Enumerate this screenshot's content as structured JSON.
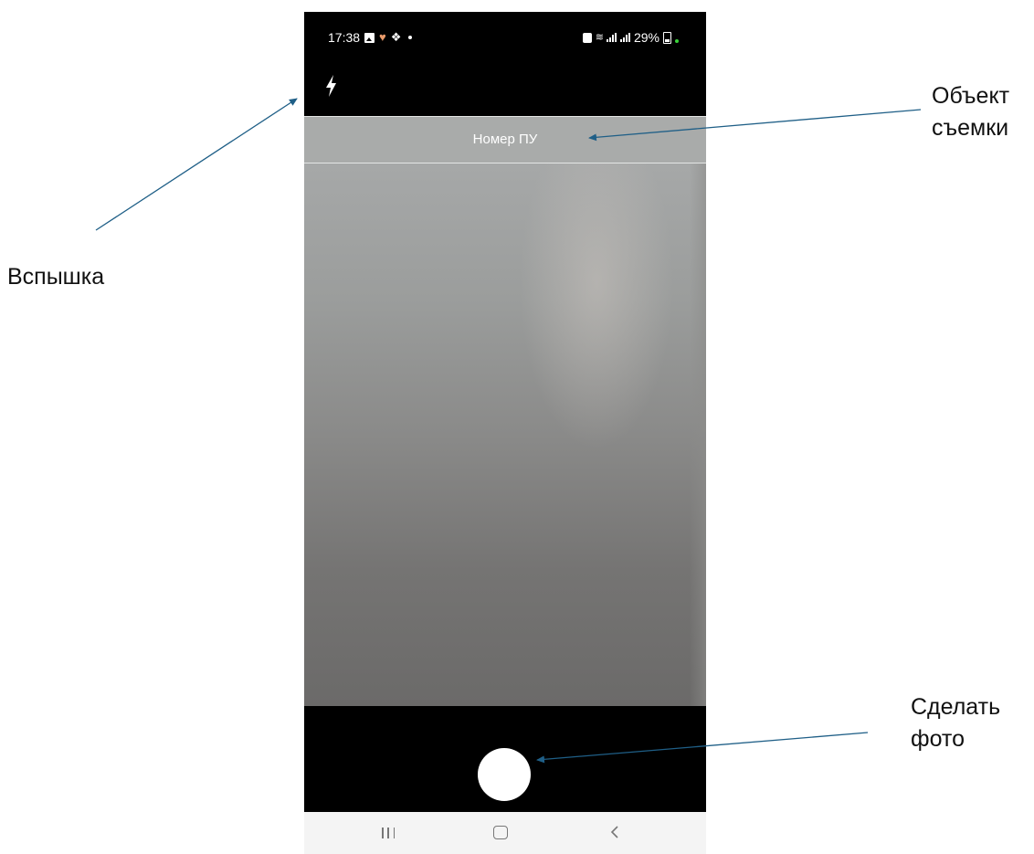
{
  "status_bar": {
    "time": "17:38",
    "battery_percent": "29%"
  },
  "camera_screen": {
    "title": "Номер ПУ",
    "icons": {
      "flash": "flash-icon",
      "shutter": "shutter-button",
      "recents": "recents-icon",
      "home": "home-icon",
      "back": "back-icon"
    }
  },
  "annotations": {
    "flash_label": "Вспышка",
    "subject_label": "Объект\nсъемки",
    "shoot_label": "Сделать\nфото"
  },
  "colors": {
    "arrow": "#1f5f87",
    "title_bar_bg": "#a9abaa",
    "nav_bar_bg": "#f4f4f4"
  }
}
